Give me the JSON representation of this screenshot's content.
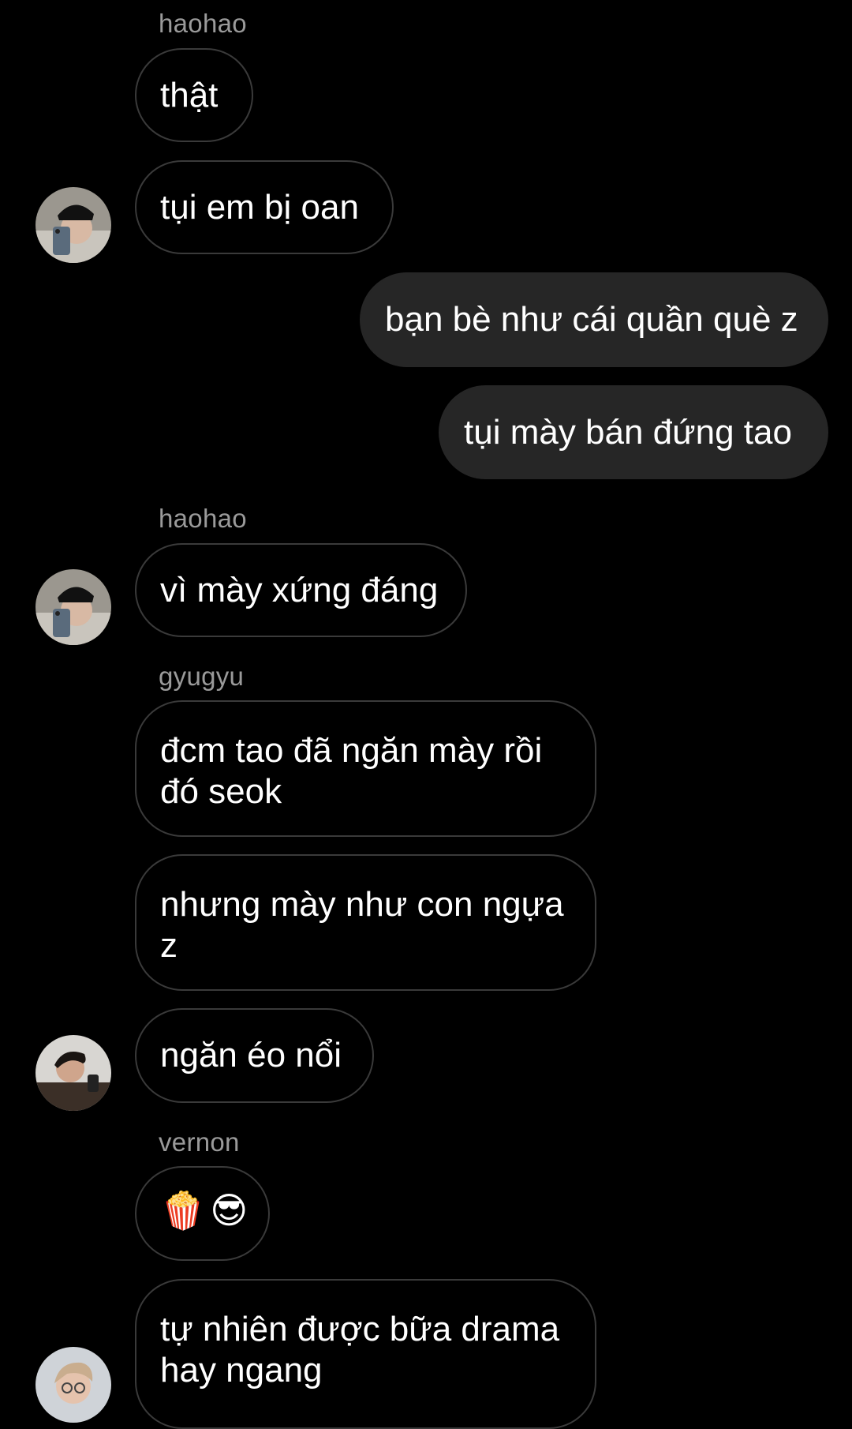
{
  "messages": [
    {
      "sender": "haohao",
      "text": "thật"
    },
    {
      "text": "tụi em bị oan"
    },
    {
      "outgoing": true,
      "text": "bạn bè như cái quần què z"
    },
    {
      "outgoing": true,
      "text": "tụi mày bán đứng tao"
    },
    {
      "sender": "haohao",
      "text": "vì mày xứng đáng"
    },
    {
      "sender": "gyugyu",
      "text": "đcm tao đã ngăn mày rồi đó seok"
    },
    {
      "text": "nhưng mày như con ngựa z"
    },
    {
      "text": "ngăn éo nổi"
    },
    {
      "sender": "vernon",
      "text": "🍿😎"
    },
    {
      "text": "tự nhiên được bữa drama hay ngang"
    }
  ]
}
